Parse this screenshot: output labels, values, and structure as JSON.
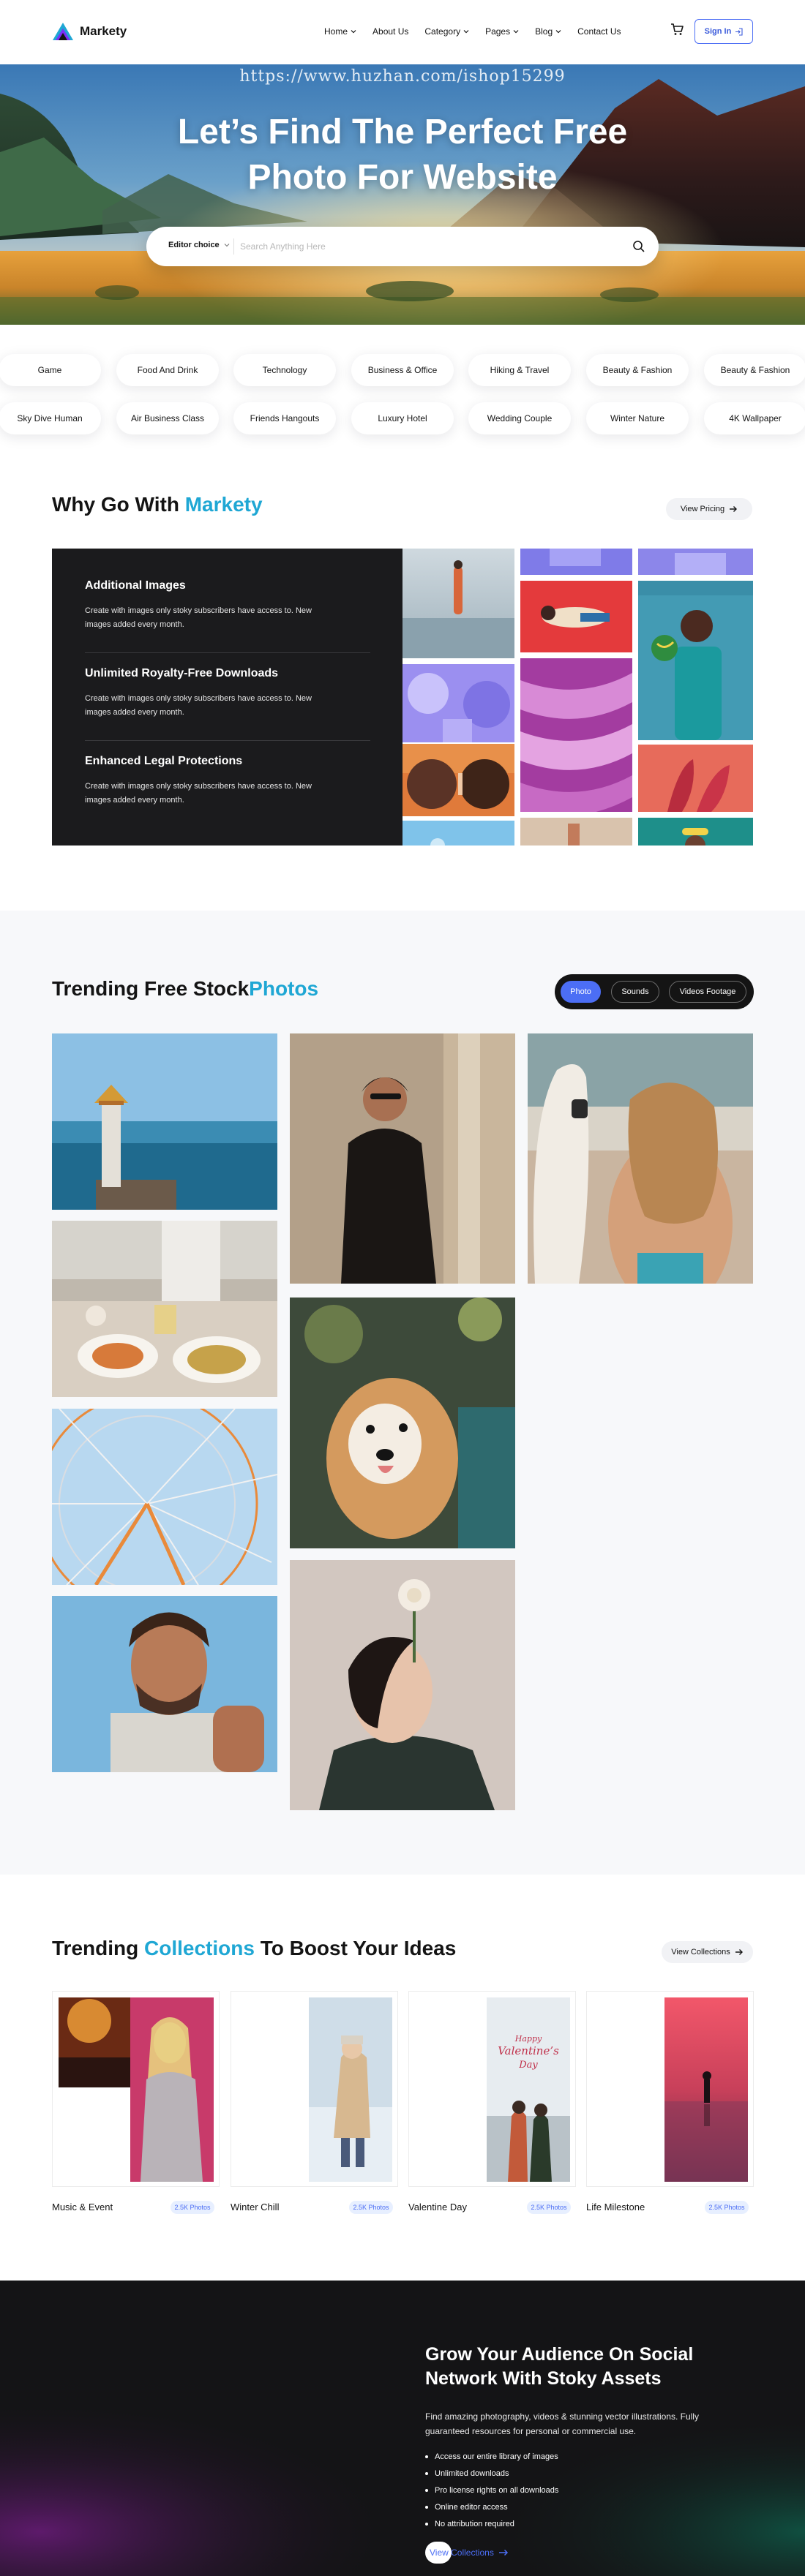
{
  "brand": {
    "name": "Markety"
  },
  "nav": [
    {
      "label": "Home",
      "dropdown": true
    },
    {
      "label": "About Us",
      "dropdown": false
    },
    {
      "label": "Category",
      "dropdown": true
    },
    {
      "label": "Pages",
      "dropdown": true
    },
    {
      "label": "Blog",
      "dropdown": true
    },
    {
      "label": "Contact Us",
      "dropdown": false
    }
  ],
  "header": {
    "signin_label": "Sign In"
  },
  "hero": {
    "watermark": "https://www.huzhan.com/ishop15299",
    "title_line1": "Let’s Find The Perfect Free",
    "title_line2": "Photo For Website",
    "search_select": "Editor choice",
    "search_placeholder": "Search Anything Here"
  },
  "tags_row1": [
    "Game",
    "Food And Drink",
    "Technology",
    "Business & Office",
    "Hiking & Travel",
    "Beauty & Fashion",
    "Beauty & Fashion"
  ],
  "tags_row2": [
    "Sky Dive Human",
    "Air Business Class",
    "Friends Hangouts",
    "Luxury Hotel",
    "Wedding Couple",
    "Winter Nature",
    "4K Wallpaper"
  ],
  "why": {
    "title_prefix": "Why Go With ",
    "title_accent": "Markety",
    "pricing_label": "View Pricing",
    "features": [
      {
        "title": "Additional Images",
        "text_line1": "Create with images only stoky subscribers have access to. New",
        "text_line2": "images added every month."
      },
      {
        "title": "Unlimited Royalty-Free Downloads",
        "text_line1": "Create with images only stoky subscribers have access to. New",
        "text_line2": "images added every month."
      },
      {
        "title": "Enhanced Legal Protections",
        "text_line1": "Create with images only stoky subscribers have access to. New",
        "text_line2": "images added every month."
      }
    ]
  },
  "trending": {
    "title_prefix": "Trending Free Stock",
    "title_accent": "Photos",
    "tabs": [
      "Photo",
      "Sounds",
      "Videos Footage"
    ],
    "active_tab": "Photo"
  },
  "collections": {
    "title_prefix": "Trending ",
    "title_accent": "Collections",
    "title_suffix": " To Boost Your Ideas",
    "view_label": "View Collections",
    "items": [
      {
        "name": "Music & Event",
        "count": "2.5K Photos"
      },
      {
        "name": "Winter Chill",
        "count": "2.5K Photos"
      },
      {
        "name": "Valentine Day",
        "count": "2.5K Photos"
      },
      {
        "name": "Life Milestone",
        "count": "2.5K Photos"
      }
    ],
    "valentine_card_text_1": "Happy",
    "valentine_card_text_2": "Valentine’s",
    "valentine_card_text_3": "Day"
  },
  "cta": {
    "title_line1": "Grow Your Audience On Social",
    "title_line2": "Network With Stoky Assets",
    "desc_line1": "Find amazing photography, videos & stunning vector illustrations. Fully",
    "desc_line2": "guaranteed resources for personal or commercial use.",
    "list": [
      "Access our entire library of images",
      "Unlimited downloads",
      "Pro license rights on all downloads",
      "Online editor access",
      "No attribution required"
    ],
    "button_label": "View Collections"
  },
  "colors": {
    "accent": "#1fa7d4",
    "primary": "#4c6ef5",
    "dark": "#1b1b1d"
  },
  "icons": [
    "logo-mark",
    "chevron-down-icon",
    "cart-icon",
    "sign-in-icon",
    "search-icon",
    "arrow-right-icon"
  ]
}
